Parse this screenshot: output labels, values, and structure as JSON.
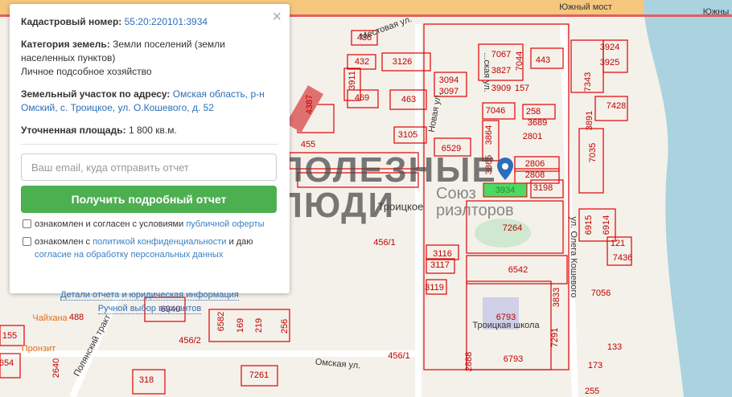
{
  "popup": {
    "cadastral_label": "Кадастровый номер:",
    "cadastral_value": "55:20:220101:3934",
    "category_label": "Категория земель:",
    "category_value": "Земли поселений (земли населенных пунктов)",
    "category_use": "Личное подсобное хозяйство",
    "address_label": "Земельный участок по адресу:",
    "address_value": "Омская область, р-н Омский, с. Троицкое, ул. О.Кошевого, д. 52",
    "area_label": "Уточненная площадь:",
    "area_value": "1 800 кв.м.",
    "email_placeholder": "Ваш email, куда отправить отчет",
    "submit": "Получить подробный отчет",
    "consent1_text": "ознакомлен и согласен с условиями ",
    "consent1_link": "публичной оферты",
    "consent2_text": "ознакомлен с ",
    "consent2_link": "политикой конфиденциальности",
    "consent2_mid": " и даю",
    "consent2_link2": "согласие на обработку персональных данных",
    "details_link": "Детали отчета и юридическая информация",
    "manual_link": "Ручной выбор вариантов",
    "close": "×"
  },
  "map": {
    "streets": [
      "Южный мост",
      "Южны",
      "Местовая ул.",
      "Новая ул.",
      "Омская ул.",
      "Полянский тракт",
      "ул. Олега Кошевого",
      "...ская ул."
    ],
    "places": [
      "Троицкое",
      "Троицкая школа",
      "Чайхана",
      "Пронзит"
    ],
    "watermark": {
      "line1": "ПОЛЕЗНЫЕ",
      "line2": "ЛЮДИ",
      "line3": "Союз",
      "line4": "риэлторов"
    },
    "selected_parcel": "3934",
    "selected_color": "#4cd964",
    "parcels": [
      "438",
      "432",
      "3126",
      "3911",
      "469",
      "463",
      "4387",
      "3094",
      "3097",
      "3105",
      "455",
      "6529",
      "7067",
      "7044",
      "443",
      "3827",
      "3909",
      "157",
      "7046",
      "258",
      "3689",
      "2801",
      "3864",
      "3865",
      "2806",
      "2808",
      "3198",
      "7264",
      "456/1",
      "3116",
      "3117",
      "6542",
      "3119",
      "6793",
      "6793",
      "2888",
      "456/1",
      "456/2",
      "6940",
      "6582",
      "169",
      "219",
      "256",
      "7261",
      "318",
      "155",
      "654",
      "3924",
      "3925",
      "7343",
      "7428",
      "3891",
      "7035",
      "6915",
      "6914",
      "121",
      "7436",
      "7056",
      "3833",
      "7291",
      "173",
      "255",
      "133",
      "2640",
      "488"
    ]
  }
}
